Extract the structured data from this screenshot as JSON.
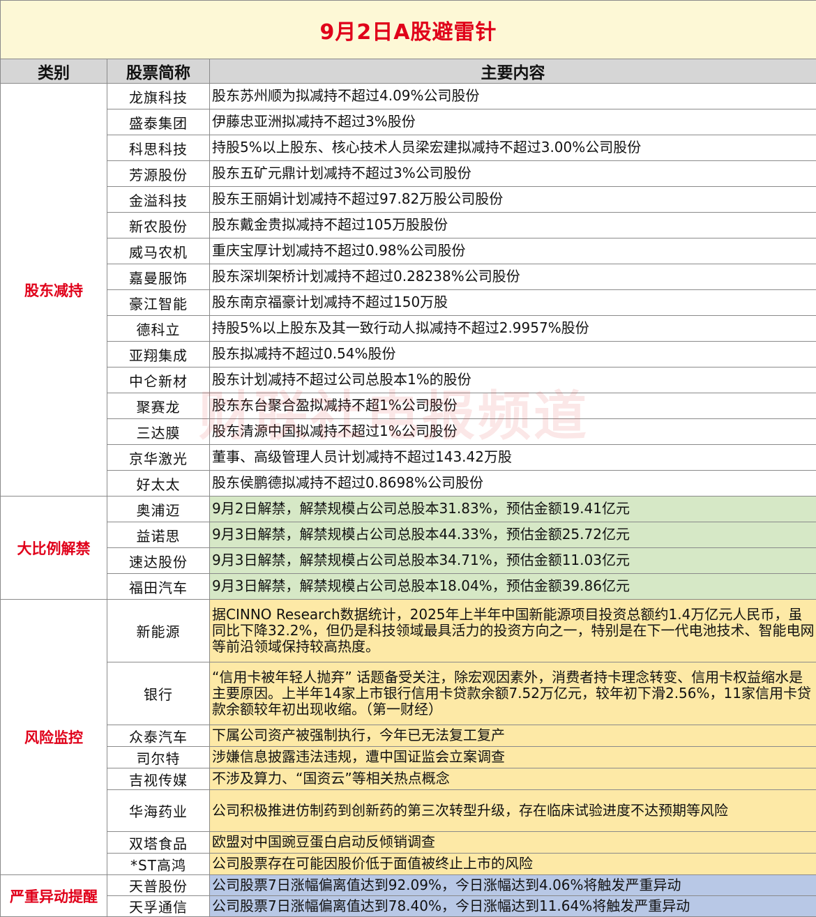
{
  "title": "9月2日A股避雷针",
  "headers": [
    "类别",
    "股票简称",
    "主要内容"
  ],
  "watermark": "财联社电报频道",
  "sections": [
    {
      "category": "股东减持",
      "rows": [
        {
          "name": "龙旗科技",
          "content": "股东苏州顺为拟减持不超过4.09%公司股份"
        },
        {
          "name": "盛泰集团",
          "content": "伊藤忠亚洲拟减持不超过3%股份"
        },
        {
          "name": "科思科技",
          "content": "持股5%以上股东、核心技术人员梁宏建拟减持不超过3.00%公司股份"
        },
        {
          "name": "芳源股份",
          "content": "股东五矿元鼎计划减持不超过3%公司股份"
        },
        {
          "name": "金溢科技",
          "content": "股东王丽娟计划减持不超过97.82万股公司股份"
        },
        {
          "name": "新农股份",
          "content": "股东戴金贵拟减持不超过105万股股份"
        },
        {
          "name": "威马农机",
          "content": "重庆宝厚计划减持不超过0.98%公司股份"
        },
        {
          "name": "嘉曼服饰",
          "content": "股东深圳架桥计划减持不超过0.28238%公司股份"
        },
        {
          "name": "豪江智能",
          "content": "股东南京福豪计划减持不超过150万股"
        },
        {
          "name": "德科立",
          "content": "持股5%以上股东及其一致行动人拟减持不超过2.9957%股份"
        },
        {
          "name": "亚翔集成",
          "content": "股东拟减持不超过0.54%股份"
        },
        {
          "name": "中仑新材",
          "content": "股东计划减持不超过公司总股本1%的股份"
        },
        {
          "name": "聚赛龙",
          "content": "股东东台聚合盈拟减持不超1%公司股份"
        },
        {
          "name": "三达膜",
          "content": "股东清源中国拟减持不超过1%公司股份"
        },
        {
          "name": "京华激光",
          "content": "董事、高级管理人员计划减持不超过143.42万股"
        },
        {
          "name": "好太太",
          "content": "股东侯鹏德拟减持不超过0.8698%公司股份"
        }
      ]
    },
    {
      "category": "大比例解禁",
      "rows": [
        {
          "name": "奥浦迈",
          "content": "9月2日解禁，解禁规模占公司总股本31.83%，预估金额19.41亿元"
        },
        {
          "name": "益诺思",
          "content": "9月3日解禁，解禁规模占公司总股本44.33%，预估金额25.72亿元"
        },
        {
          "name": "速达股份",
          "content": "9月3日解禁，解禁规模占公司总股本34.71%，预估金额11.03亿元"
        },
        {
          "name": "福田汽车",
          "content": "9月3日解禁，解禁规模占公司总股本18.04%，预估金额39.86亿元"
        }
      ]
    },
    {
      "category": "风险监控",
      "rows": [
        {
          "name": "新能源",
          "content": "据CINNO Research数据统计，2025年上半年中国新能源项目投资总额约1.4万亿元人民币，虽同比下降32.2%，但仍是科技领域最具活力的投资方向之一，特别是在下一代电池技术、智能电网等前沿领域保持较高热度。"
        },
        {
          "name": "银行",
          "content": "“信用卡被年轻人抛弃” 话题备受关注，除宏观因素外，消费者持卡理念转变、信用卡权益缩水是主要原因。上半年14家上市银行信用卡贷款余额7.52万亿元，较年初下滑2.56%，11家信用卡贷款余额较年初出现收缩。（第一财经）"
        },
        {
          "name": "众泰汽车",
          "content": "下属公司资产被强制执行，今年已无法复工复产"
        },
        {
          "name": "司尔特",
          "content": "涉嫌信息披露违法违规，遭中国证监会立案调查"
        },
        {
          "name": "吉视传媒",
          "content": "不涉及算力、“国资云”等相关热点概念"
        },
        {
          "name": "华海药业",
          "content": "公司积极推进仿制药到创新药的第三次转型升级，存在临床试验进度不达预期等风险"
        },
        {
          "name": "双塔食品",
          "content": "欧盟对中国豌豆蛋白启动反倾销调查"
        },
        {
          "name": "*ST高鸿",
          "content": "公司股票存在可能因股价低于面值被终止上市的风险"
        }
      ]
    },
    {
      "category": "严重异动提醒",
      "rows": [
        {
          "name": "天普股份",
          "content": "公司股票7日涨幅偏离值达到92.09%，今日涨幅达到4.06%将触发严重异动"
        },
        {
          "name": "天孚通信",
          "content": "公司股票7日涨幅偏离值达到78.40%，今日涨幅达到11.64%将触发严重异动"
        }
      ]
    }
  ]
}
